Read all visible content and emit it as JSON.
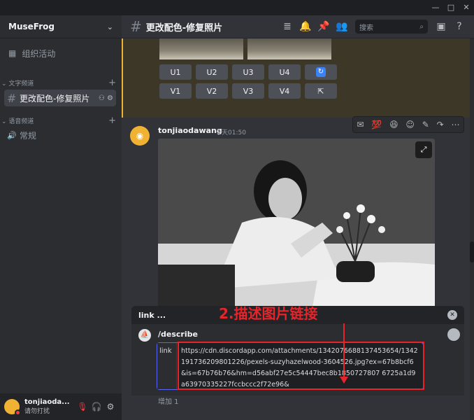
{
  "server": {
    "name": "MuseFrog"
  },
  "sidebar": {
    "events_label": "组织活动",
    "text_category": "文字频道",
    "active_channel": "更改配色-修复照片",
    "voice_category": "语音频道",
    "voice_channel": "常规"
  },
  "user": {
    "name": "tonjiaoda...",
    "status": "请勿打扰"
  },
  "channel_header": {
    "title": "更改配色-修复照片",
    "search_placeholder": "搜索"
  },
  "buttons": {
    "row1": [
      "U1",
      "U2",
      "U3",
      "U4"
    ],
    "row2": [
      "V1",
      "V2",
      "V3",
      "V4"
    ]
  },
  "message": {
    "author": "tonjiaodawang",
    "timestamp": "今天01:50"
  },
  "composer": {
    "option_header": "link ...",
    "command": "/describe",
    "param_label": "link",
    "param_value": "https://cdn.discordapp.com/attachments/1342076688137453654/1342191736209801226/pexels-suzyhazelwood-3604526.jpg?ex=67b8bcf6&is=67b76b76&hm=d56abf27e5c54447bec8b1850727807 6725a1d9a63970335227fccbccc2f72e96&",
    "add_more": "增加 1"
  },
  "annotation": {
    "text": "2.描述图片链接",
    "color": "#e5252a"
  },
  "colors": {
    "accent": "#5865f2",
    "dnd": "#f23f43",
    "bot_avatar": "#f0b232"
  }
}
